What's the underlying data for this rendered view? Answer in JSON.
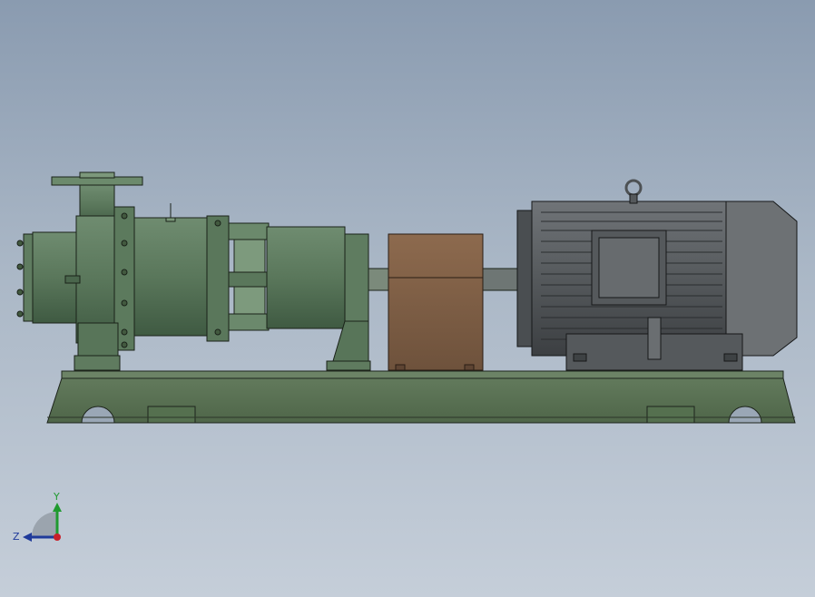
{
  "viewport": {
    "background_top": "#8a9bb0",
    "background_bottom": "#c5ced9"
  },
  "model": {
    "components": [
      {
        "name": "pump-casing",
        "color": "#5d7a5e"
      },
      {
        "name": "bearing-frame",
        "color": "#5f7c60"
      },
      {
        "name": "coupling-guard",
        "color": "#7d5e45"
      },
      {
        "name": "electric-motor",
        "color": "#5a5e60"
      },
      {
        "name": "baseplate",
        "color": "#5d7358"
      }
    ]
  },
  "triad": {
    "y_label": "Y",
    "z_label": "Z",
    "y_color": "#1f9a2f",
    "z_color": "#1f3a9a",
    "origin_color": "#c8202a"
  }
}
